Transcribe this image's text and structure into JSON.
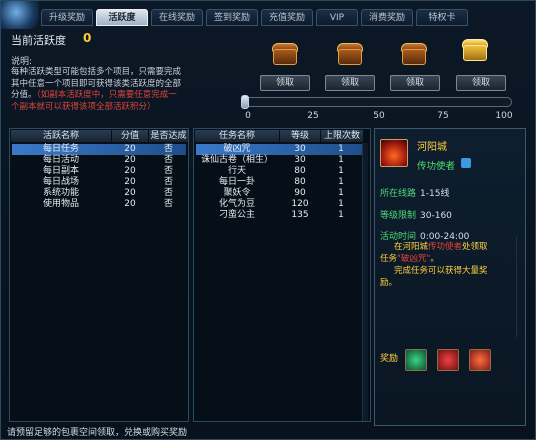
{
  "tabs": [
    "升级奖励",
    "活跃度",
    "在线奖励",
    "签到奖励",
    "充值奖励",
    "VIP",
    "消费奖励",
    "特权卡"
  ],
  "activity": {
    "label": "当前活跃度",
    "value": "0"
  },
  "description": {
    "title": "说明:",
    "line1": "每种活跃类型可能包括多个项目，只需要完成",
    "line2": "其中任意一个项目即可获得该类活跃度的全部",
    "line3": "分值。",
    "line3_red": "（如副本活跃度中，只需要任意完成一",
    "line4_red": "个副本就可以获得该项全部活跃积分）"
  },
  "chests": [
    {
      "icon": "treasure-chest-icon",
      "claim": "领取"
    },
    {
      "icon": "treasure-chest-icon",
      "claim": "领取"
    },
    {
      "icon": "treasure-chest-icon",
      "claim": "领取"
    },
    {
      "icon": "golden-treasure-chest-icon",
      "claim": "领取"
    }
  ],
  "progress": {
    "value": 0,
    "max": 100,
    "ticks": [
      "0",
      "25",
      "50",
      "75",
      "100"
    ]
  },
  "activity_table": {
    "headers": [
      "活跃名称",
      "分值",
      "是否达成"
    ],
    "rows": [
      [
        "每日任务",
        "20",
        "否"
      ],
      [
        "每日活动",
        "20",
        "否"
      ],
      [
        "每日副本",
        "20",
        "否"
      ],
      [
        "每日战场",
        "20",
        "否"
      ],
      [
        "系统功能",
        "20",
        "否"
      ],
      [
        "使用物品",
        "20",
        "否"
      ]
    ]
  },
  "task_table": {
    "headers": [
      "任务名称",
      "等级",
      "上限次数"
    ],
    "rows": [
      [
        "破凶咒",
        "30",
        "1"
      ],
      [
        "诛仙古卷（相生）",
        "30",
        "1"
      ],
      [
        "行天",
        "80",
        "1"
      ],
      [
        "每日一卦",
        "80",
        "1"
      ],
      [
        "聚妖令",
        "90",
        "1"
      ],
      [
        "化气为豆",
        "120",
        "1"
      ],
      [
        "刁蛮公主",
        "135",
        "1"
      ]
    ]
  },
  "info": {
    "city": "河阳城",
    "npc": "传功使者",
    "route_label": "所在线路",
    "route": "1-15线",
    "level_label": "等级限制",
    "level": "30-160",
    "time_label": "活动时间",
    "time": "0:00-24:00",
    "quest_1": "在河阳城",
    "quest_npc": "传功使者",
    "quest_2": "处领取",
    "quest_3": "任务",
    "quest_name": "\"破凶咒\"",
    "quest_4": "。",
    "quest_5": "完成任务可以获得大量奖",
    "quest_6": "励。",
    "reward_label": "奖励",
    "rewards": [
      "jade-reward-icon",
      "red-gift-reward-icon",
      "red-star-reward-icon"
    ]
  },
  "footer": "请预留足够的包裹空间领取，兑换或购买奖励"
}
